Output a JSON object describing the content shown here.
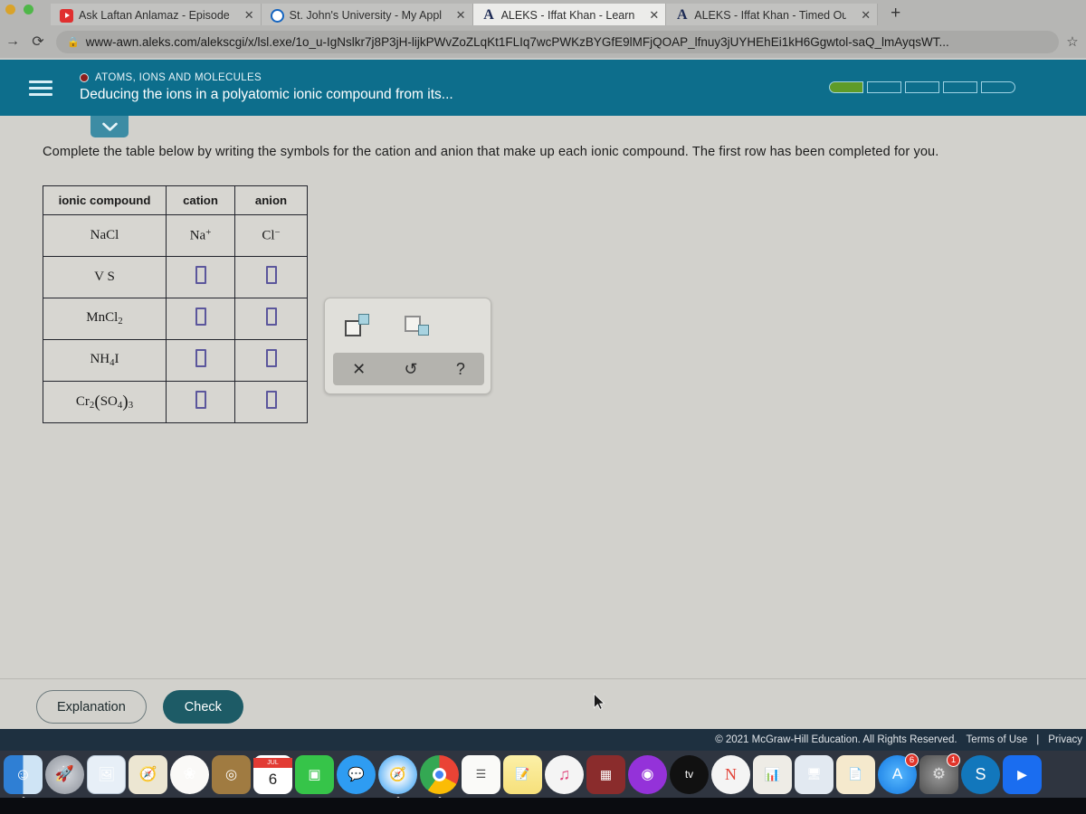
{
  "browser": {
    "tabs": [
      {
        "title": "Ask Laftan Anlamaz - Episode",
        "icon": "youtube-icon",
        "active": false
      },
      {
        "title": "St. John's University - My Appl",
        "icon": "circle-o-icon",
        "active": false
      },
      {
        "title": "ALEKS - Iffat Khan - Learn",
        "icon": "aleks-a-icon",
        "active": true
      },
      {
        "title": "ALEKS - Iffat Khan - Timed Out",
        "icon": "aleks-a-icon",
        "active": false
      }
    ],
    "new_tab_label": "+",
    "close_label": "✕",
    "forward_label": "→",
    "reload_label": "⟳",
    "lock_label": "🔒",
    "star_label": "☆",
    "url": "www-awn.aleks.com/alekscgi/x/lsl.exe/1o_u-IgNslkr7j8P3jH-lijkPWvZoZLqKt1FLIq7wcPWKzBYGfE9lMFjQOAP_lfnuy3jUYHEhEi1kH6Ggwtol-saQ_lmAyqsWT..."
  },
  "aleks_header": {
    "kicker": "ATOMS, IONS AND MOLECULES",
    "title": "Deducing the ions in a polyatomic ionic compound from its...",
    "menu_label": "hamburger-menu",
    "progress": {
      "total_segments": 5,
      "filled_segments": 1,
      "fill_color": "#5f9b28",
      "border_color": "#9fd3e4"
    },
    "bar_color": "#0d6e8c"
  },
  "content": {
    "collapse_chevron": "⌄",
    "instruction": "Complete the table below by writing the symbols for the cation and anion that make up each ionic compound. The first row has been completed for you."
  },
  "table": {
    "headers": [
      "ionic compound",
      "cation",
      "anion"
    ],
    "rows": [
      {
        "compound_html": "NaCl",
        "cation_html": "Na<sup>+</sup>",
        "anion_html": "Cl<sup>−</sup>",
        "filled": true
      },
      {
        "compound_html": "V S",
        "cation_html": "",
        "anion_html": "",
        "filled": false
      },
      {
        "compound_html": "MnCl<sub>2</sub>",
        "cation_html": "",
        "anion_html": "",
        "filled": false
      },
      {
        "compound_html": "NH<sub>4</sub>I",
        "cation_html": "",
        "anion_html": "",
        "filled": false
      },
      {
        "compound_html": "Cr<sub>2</sub><span class=\"paren\">(</span>SO<sub>4</sub><span class=\"paren\">)</span><sub>3</sub>",
        "cation_html": "",
        "anion_html": "",
        "filled": false
      }
    ],
    "empty_input_color": "#5b569c"
  },
  "palette": {
    "superscript_label": "superscript-icon",
    "subscript_label": "subscript-icon",
    "clear_label": "✕",
    "undo_label": "↺",
    "help_label": "?"
  },
  "actions": {
    "explanation_label": "Explanation",
    "check_label": "Check",
    "check_color": "#1d5b66"
  },
  "footer": {
    "copyright": "© 2021 McGraw-Hill Education. All Rights Reserved.",
    "terms": "Terms of Use",
    "separator": "|",
    "privacy": "Privacy"
  },
  "dock": {
    "items": [
      {
        "name": "finder",
        "glyph": "🙂",
        "bg": "#1e86d8",
        "badge": ""
      },
      {
        "name": "launchpad",
        "glyph": "🚀",
        "bg": "#9aa0a6",
        "badge": ""
      },
      {
        "name": "preview",
        "glyph": "🖼",
        "bg": "#dce7f2",
        "badge": ""
      },
      {
        "name": "maps",
        "glyph": "🗺",
        "bg": "#eae3cf",
        "badge": ""
      },
      {
        "name": "photos",
        "glyph": "🌸",
        "bg": "#f4f2ef",
        "badge": ""
      },
      {
        "name": "contacts",
        "glyph": "📒",
        "bg": "#9c7a43",
        "badge": ""
      },
      {
        "name": "calendar",
        "glyph": "6",
        "bg": "#ffffff",
        "badge": ""
      },
      {
        "name": "facetime",
        "glyph": "📹",
        "bg": "#3cc84a",
        "badge": ""
      },
      {
        "name": "messages",
        "glyph": "💬",
        "bg": "#2f9ff0",
        "badge": ""
      },
      {
        "name": "safari",
        "glyph": "🧭",
        "bg": "#1f9cf0",
        "badge": ""
      },
      {
        "name": "chrome",
        "glyph": "●",
        "bg": "#ffffff",
        "badge": ""
      },
      {
        "name": "reminders",
        "glyph": "☰",
        "bg": "#f7f6f4",
        "badge": ""
      },
      {
        "name": "notes",
        "glyph": "📝",
        "bg": "#f5e27a",
        "badge": ""
      },
      {
        "name": "music",
        "glyph": "♫",
        "bg": "#f2f2f2",
        "badge": ""
      },
      {
        "name": "photo-booth",
        "glyph": "📷",
        "bg": "#8c2b2b",
        "badge": ""
      },
      {
        "name": "podcasts",
        "glyph": "◉",
        "bg": "#8f2bd6",
        "badge": ""
      },
      {
        "name": "apple-tv",
        "glyph": "tv",
        "bg": "#111111",
        "badge": ""
      },
      {
        "name": "news",
        "glyph": "N",
        "bg": "#f2f2f2",
        "badge": ""
      },
      {
        "name": "numbers",
        "glyph": "📊",
        "bg": "#eceae4",
        "badge": ""
      },
      {
        "name": "keynote",
        "glyph": "🖥",
        "bg": "#dfe6ee",
        "badge": ""
      },
      {
        "name": "pages",
        "glyph": "📄",
        "bg": "#f3e7c9",
        "badge": ""
      },
      {
        "name": "app-store",
        "glyph": "A",
        "bg": "#1f8ff5",
        "badge": "6"
      },
      {
        "name": "system-preferences",
        "glyph": "⚙",
        "bg": "#6e6e6e",
        "badge": "1"
      },
      {
        "name": "skype",
        "glyph": "S",
        "bg": "#1277bc",
        "badge": ""
      },
      {
        "name": "zoom",
        "glyph": "📹",
        "bg": "#1a6df0",
        "badge": ""
      }
    ],
    "calendar_month": "JUL",
    "calendar_day": "6"
  }
}
